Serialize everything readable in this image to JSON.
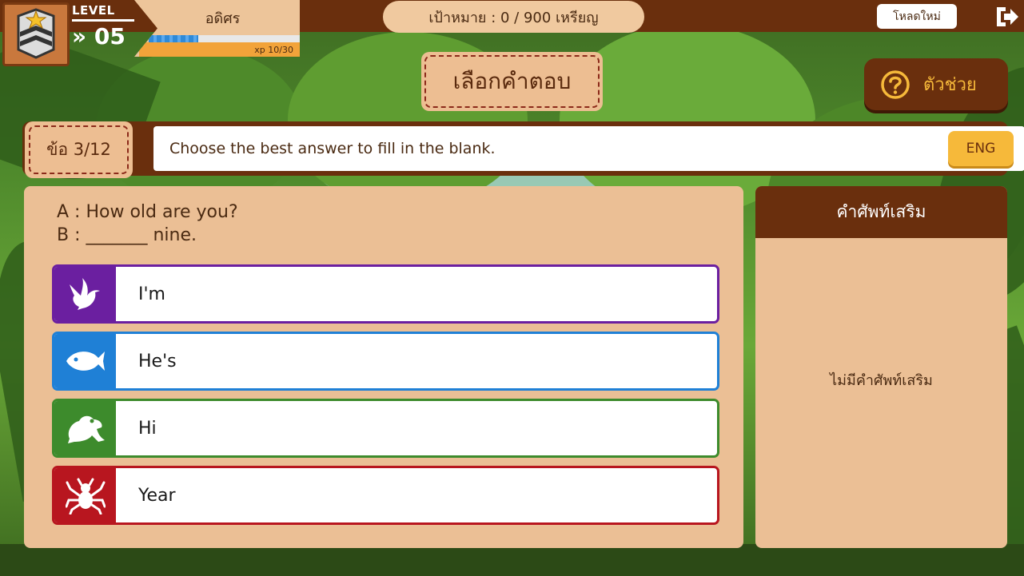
{
  "player": {
    "level_label": "LEVEL",
    "level_number": "» 05",
    "name": "อดิศร",
    "xp_text": "xp 10/30",
    "xp_fraction": 0.33
  },
  "goal": {
    "text": "เป้าหมาย : 0 / 900 เหรียญ"
  },
  "toolbar": {
    "reload_label": "โหลดใหม่"
  },
  "mode": {
    "title": "เลือกคำตอบ"
  },
  "help": {
    "label": "ตัวช่วย"
  },
  "question": {
    "number": "ข้อ 3/12",
    "instruction": "Choose the best answer to fill in the blank.",
    "lang_button": "ENG",
    "dialog_line_a": "A : How old are you?",
    "dialog_line_b": "B : _______ nine."
  },
  "choices": [
    {
      "label": "I'm",
      "icon": "bird-icon",
      "color": "#6b1fa0"
    },
    {
      "label": "He's",
      "icon": "fish-icon",
      "color": "#1f80d6"
    },
    {
      "label": "Hi",
      "icon": "frog-icon",
      "color": "#3d8b2c"
    },
    {
      "label": "Year",
      "icon": "spider-icon",
      "color": "#b8161f"
    }
  ],
  "vocab": {
    "title": "คำศัพท์เสริม",
    "empty_text": "ไม่มีคำศัพท์เสริม"
  }
}
